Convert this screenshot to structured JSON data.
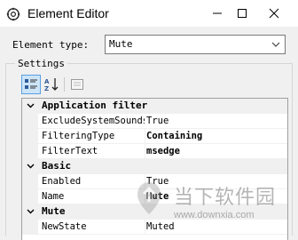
{
  "window": {
    "title": "Element Editor",
    "icons": {
      "app": "gear-puzzle-icon",
      "minimize": "minimize-icon",
      "maximize": "maximize-icon",
      "close": "close-icon"
    }
  },
  "element_type": {
    "label": "Element type:",
    "selected": "Mute"
  },
  "settings": {
    "caption": "Settings",
    "toolbar": {
      "categorized_icon": "categorized-view-icon",
      "alphabetical_icon": "sort-az-icon",
      "property_pages_icon": "property-pages-icon"
    },
    "categories": [
      {
        "name": "Application filter",
        "properties": [
          {
            "name": "ExcludeSystemSounds",
            "value": "True",
            "bold": false
          },
          {
            "name": "FilteringType",
            "value": "Containing",
            "bold": true
          },
          {
            "name": "FilterText",
            "value": "msedge",
            "bold": true
          }
        ]
      },
      {
        "name": "Basic",
        "properties": [
          {
            "name": "Enabled",
            "value": "True",
            "bold": false
          },
          {
            "name": "Name",
            "value": "Mute",
            "bold": true
          }
        ]
      },
      {
        "name": "Mute",
        "properties": [
          {
            "name": "NewState",
            "value": "Muted",
            "bold": false
          }
        ]
      }
    ]
  },
  "watermark": {
    "text": "当下软件园",
    "url": "www.downxia.com"
  },
  "colors": {
    "selection_border": "#5a9fe0",
    "selection_fill": "#cce4f7",
    "panel": "#f0f0f0"
  }
}
